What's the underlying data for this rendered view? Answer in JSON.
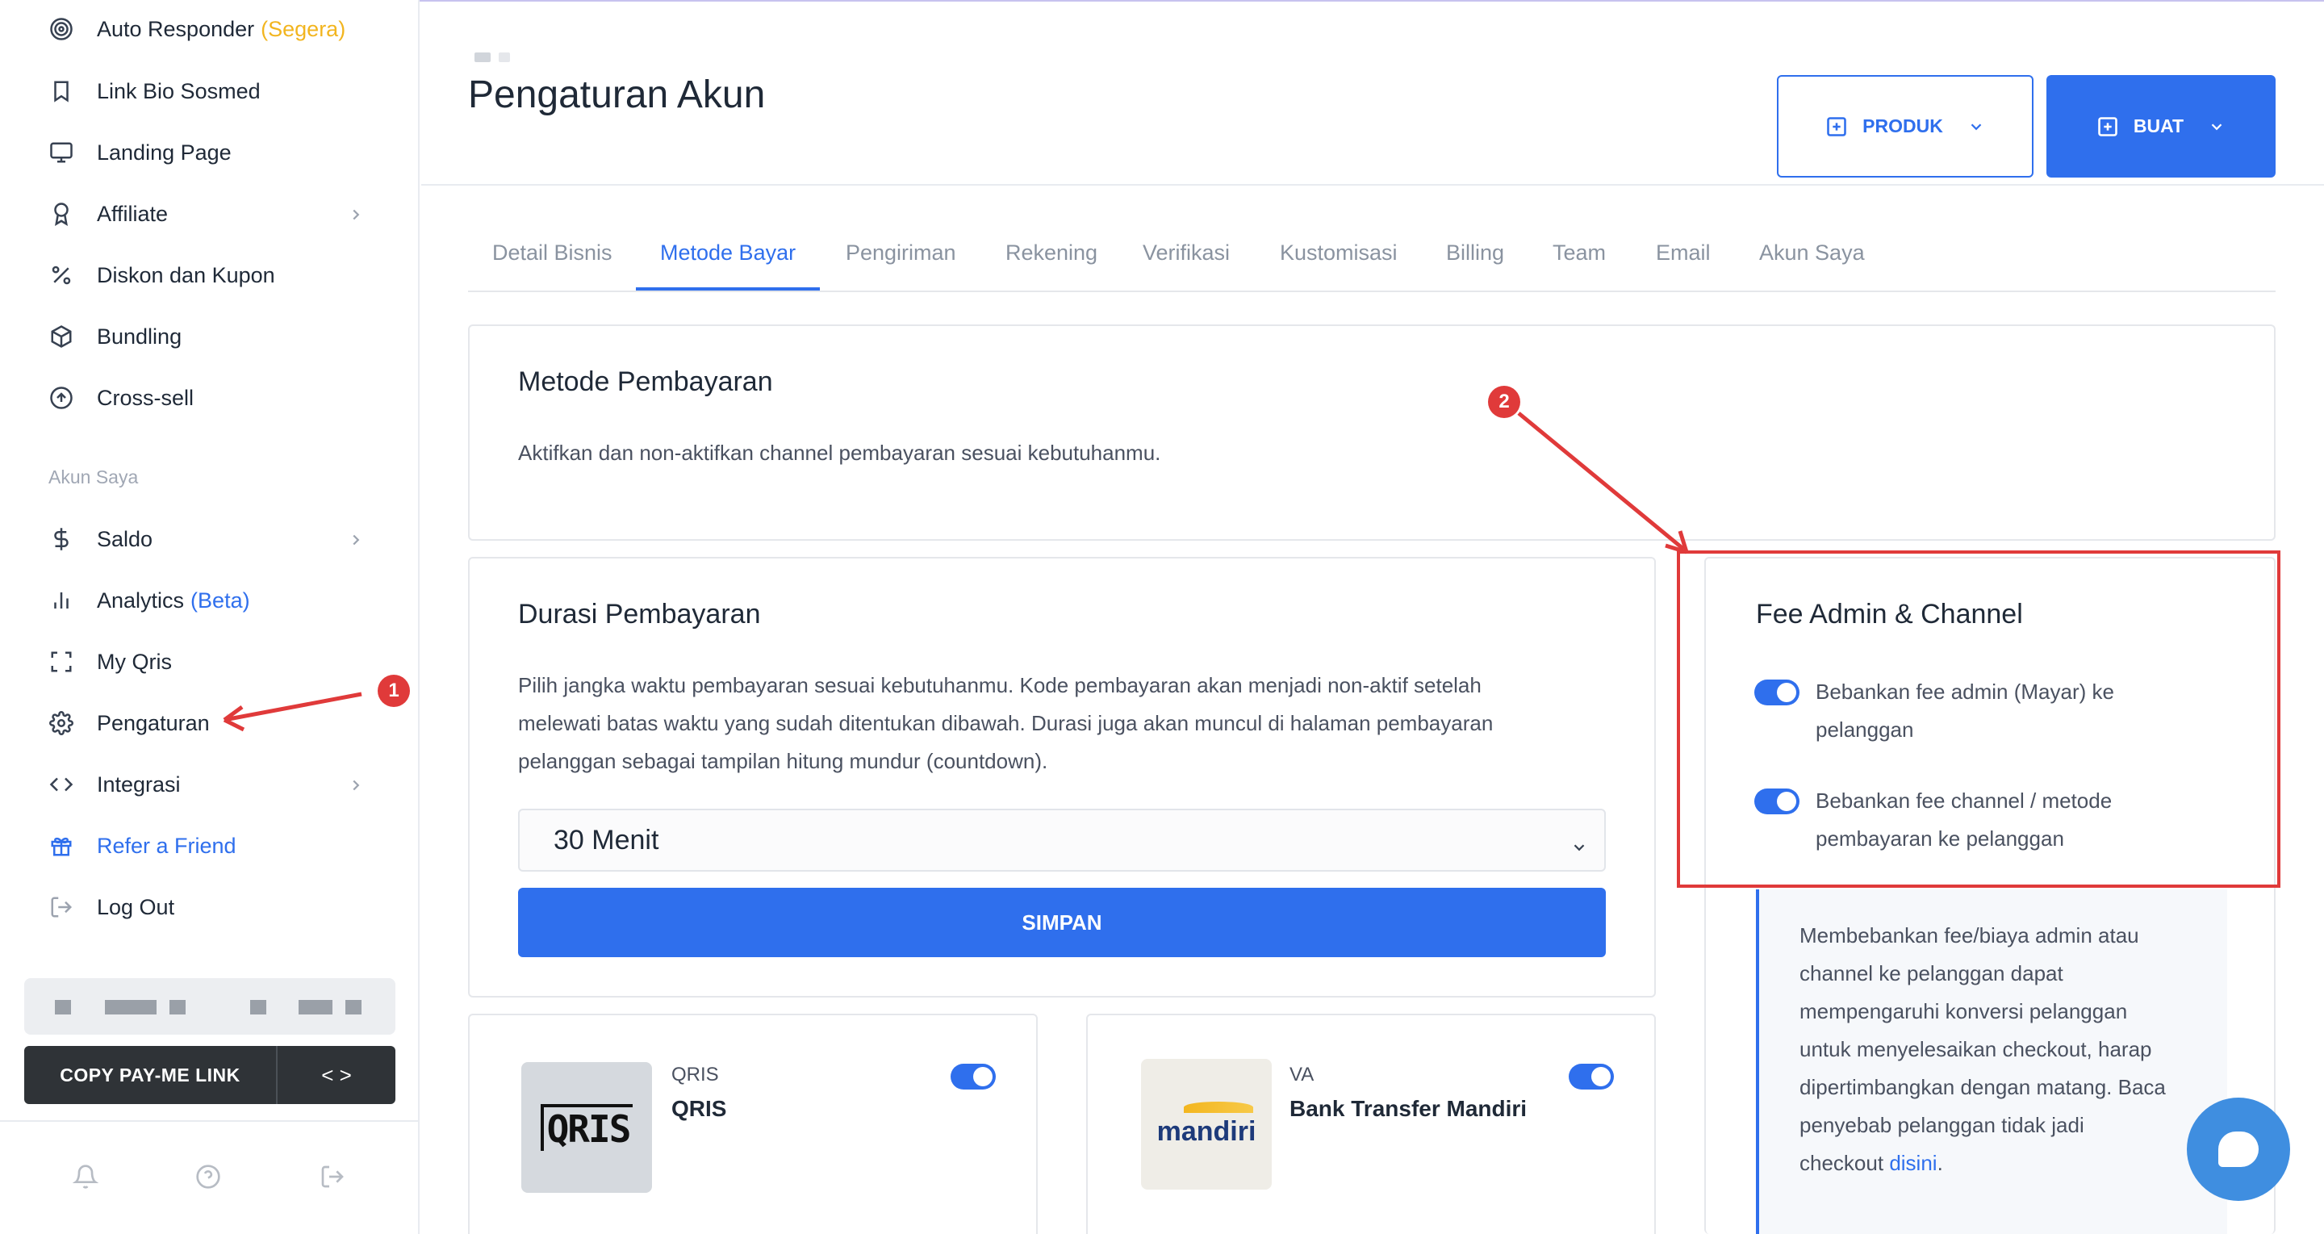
{
  "sidebar": {
    "items": [
      {
        "label": "Auto Responder",
        "tag": "(Segera)",
        "icon": "target-icon"
      },
      {
        "label": "Link Bio Sosmed",
        "icon": "bookmark-icon"
      },
      {
        "label": "Landing Page",
        "icon": "monitor-icon"
      },
      {
        "label": "Affiliate",
        "icon": "award-icon"
      },
      {
        "label": "Diskon dan Kupon",
        "icon": "percent-icon"
      },
      {
        "label": "Bundling",
        "icon": "box-icon"
      },
      {
        "label": "Cross-sell",
        "icon": "arrow-up-circle-icon"
      }
    ],
    "section_label": "Akun Saya",
    "account_items": [
      {
        "label": "Saldo",
        "icon": "dollar-icon"
      },
      {
        "label": "Analytics",
        "tag": "(Beta)",
        "icon": "bar-chart-icon"
      },
      {
        "label": "My Qris",
        "icon": "scan-icon"
      },
      {
        "label": "Pengaturan",
        "icon": "gear-icon"
      },
      {
        "label": "Integrasi",
        "icon": "code-icon"
      },
      {
        "label": "Refer a Friend",
        "icon": "gift-icon"
      },
      {
        "label": "Log Out",
        "icon": "logout-icon"
      }
    ],
    "copy_link_label": "COPY PAY-ME LINK",
    "code_label": "< >"
  },
  "header": {
    "title": "Pengaturan Akun",
    "produk_label": "PRODUK",
    "buat_label": "BUAT"
  },
  "tabs": [
    {
      "label": "Detail Bisnis"
    },
    {
      "label": "Metode Bayar",
      "active": true
    },
    {
      "label": "Pengiriman"
    },
    {
      "label": "Rekening"
    },
    {
      "label": "Verifikasi"
    },
    {
      "label": "Kustomisasi"
    },
    {
      "label": "Billing"
    },
    {
      "label": "Team"
    },
    {
      "label": "Email"
    },
    {
      "label": "Akun Saya"
    }
  ],
  "metode": {
    "title": "Metode Pembayaran",
    "desc": "Aktifkan dan non-aktifkan channel pembayaran sesuai kebutuhanmu."
  },
  "durasi": {
    "title": "Durasi Pembayaran",
    "desc_1": "Pilih jangka waktu pembayaran sesuai kebutuhanmu. Kode pembayaran akan menjadi non-aktif setelah",
    "desc_2": "melewati batas waktu yang sudah ditentukan dibawah. Durasi juga akan muncul di halaman pembayaran",
    "desc_3": "pelanggan sebagai tampilan hitung mundur (countdown).",
    "selected": "30 Menit",
    "save_label": "SIMPAN"
  },
  "fee": {
    "title": "Fee Admin & Channel",
    "opt1_line1": "Bebankan fee admin (Mayar) ke",
    "opt1_line2": "pelanggan",
    "opt1_on": true,
    "opt2_line1": "Bebankan fee channel / metode",
    "opt2_line2": "pembayaran ke pelanggan",
    "opt2_on": true,
    "info_1": "Membebankan fee/biaya admin atau",
    "info_2": "channel ke pelanggan dapat",
    "info_3": "mempengaruhi konversi pelanggan",
    "info_4": "untuk menyelesaikan checkout, harap",
    "info_5": "dipertimbangkan dengan matang. Baca",
    "info_6": "penyebab pelanggan tidak jadi",
    "info_7": "checkout",
    "info_link": "disini",
    "info_end": "."
  },
  "payments": [
    {
      "type": "QRIS",
      "name": "QRIS",
      "logo_text": "QRIS",
      "enabled": true
    },
    {
      "type": "VA",
      "name": "Bank Transfer Mandiri",
      "logo_text": "mandiri",
      "enabled": true
    }
  ],
  "annotations": {
    "badge1": "1",
    "badge2": "2"
  },
  "colors": {
    "accent": "#2f6fed",
    "annotation": "#e03a3a",
    "yellow_tag": "#f2b51f"
  }
}
